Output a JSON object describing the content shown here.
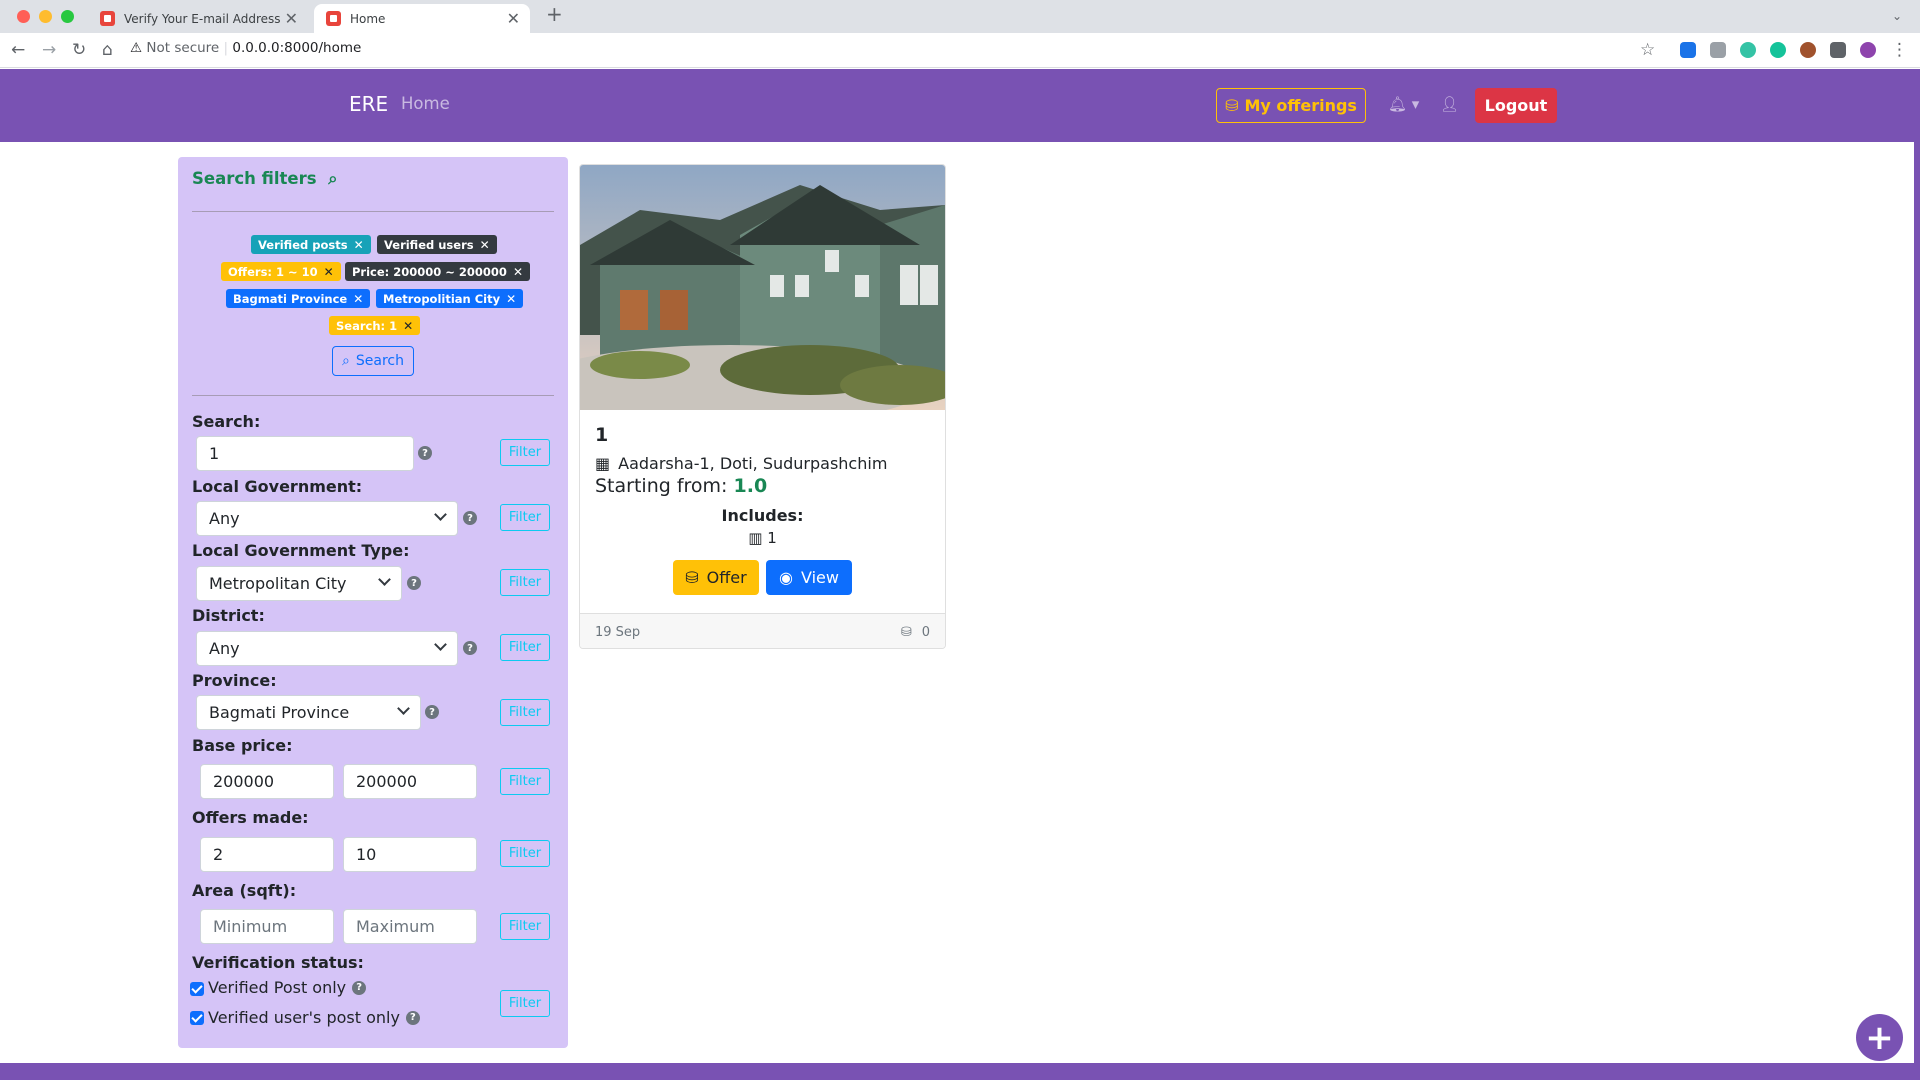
{
  "browser": {
    "tabs": [
      {
        "title": "Verify Your E-mail Address"
      },
      {
        "title": "Home"
      }
    ],
    "security_label": "Not secure",
    "url": "0.0.0.0:8000/home"
  },
  "navbar": {
    "brand": "ERE",
    "home_link": "Home",
    "my_offerings": "My offerings",
    "logout": "Logout"
  },
  "sidebar": {
    "title": "Search filters",
    "badges": [
      {
        "label": "Verified posts",
        "color": "#17a2b8"
      },
      {
        "label": "Verified users",
        "color": "#343a40"
      },
      {
        "label": "Offers: 1 ~ 10",
        "color": "#ffc107"
      },
      {
        "label": "Price: 200000 ~ 200000",
        "color": "#343a40"
      },
      {
        "label": "Bagmati Province",
        "color": "#0d6efd"
      },
      {
        "label": "Metropolitian City",
        "color": "#0d6efd"
      },
      {
        "label": "Search: 1",
        "color": "#ffc107"
      }
    ],
    "search_button": "Search",
    "filter_button": "Filter",
    "fields": {
      "search": {
        "label": "Search:",
        "value": "1"
      },
      "local_government": {
        "label": "Local Government:",
        "value": "Any"
      },
      "local_government_type": {
        "label": "Local Government Type:",
        "value": "Metropolitan City"
      },
      "district": {
        "label": "District:",
        "value": "Any"
      },
      "province": {
        "label": "Province:",
        "value": "Bagmati Province"
      },
      "base_price": {
        "label": "Base price:",
        "min": "200000",
        "max": "200000"
      },
      "offers_made": {
        "label": "Offers made:",
        "min": "2",
        "max": "10"
      },
      "area": {
        "label": "Area (sqft):",
        "min_placeholder": "Minimum",
        "max_placeholder": "Maximum"
      },
      "verification": {
        "label": "Verification status:",
        "verified_post": {
          "label": "Verified Post only",
          "checked": true
        },
        "verified_user": {
          "label": "Verified user's post only",
          "checked": true
        }
      }
    }
  },
  "card": {
    "title": "1",
    "location": "Aadarsha-1, Doti, Sudurpashchim",
    "price_label": "Starting from:",
    "price_value": "1.0",
    "includes_label": "Includes:",
    "includes_value": "1",
    "offer_button": "Offer",
    "view_button": "View",
    "date": "19 Sep",
    "offer_count": "0"
  },
  "colors": {
    "navbar": "#7952b3",
    "sidebar": "#d5c4f7",
    "accent_green": "#198754",
    "primary": "#0d6efd",
    "warning": "#ffc107",
    "danger": "#dc3545"
  }
}
